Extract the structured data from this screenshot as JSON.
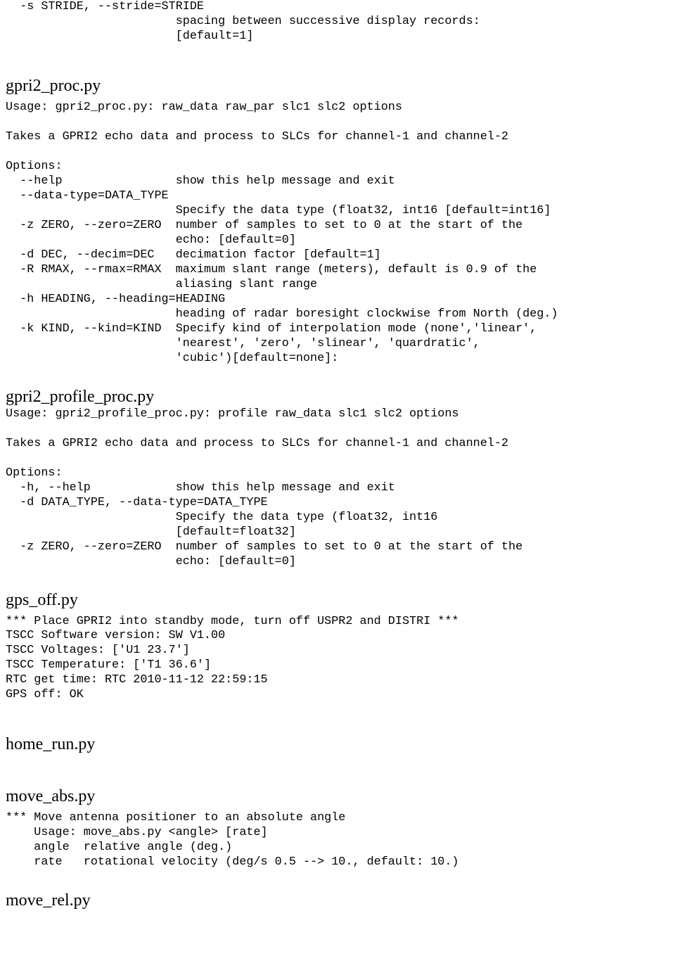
{
  "frag_top": "  -s STRIDE, --stride=STRIDE\n                        spacing between successive display records:\n                        [default=1]",
  "sections": [
    {
      "title": "gpri2_proc.py",
      "title_gap": "large",
      "body_before_gap": "small",
      "body": "Usage: gpri2_proc.py: raw_data raw_par slc1 slc2 options\n\nTakes a GPRI2 echo data and process to SLCs for channel-1 and channel-2\n\nOptions:\n  --help                show this help message and exit\n  --data-type=DATA_TYPE\n                        Specify the data type (float32, int16 [default=int16]\n  -z ZERO, --zero=ZERO  number of samples to set to 0 at the start of the\n                        echo: [default=0]\n  -d DEC, --decim=DEC   decimation factor [default=1]\n  -R RMAX, --rmax=RMAX  maximum slant range (meters), default is 0.9 of the\n                        aliasing slant range\n  -h HEADING, --heading=HEADING\n                        heading of radar boresight clockwise from North (deg.)\n  -k KIND, --kind=KIND  Specify kind of interpolation mode (none','linear',\n                        'nearest', 'zero', 'slinear', 'quardratic',\n                        'cubic')[default=none]:"
    },
    {
      "title": "gpri2_profile_proc.py",
      "title_gap": "med",
      "body_before_gap": "none",
      "body": "Usage: gpri2_profile_proc.py: profile raw_data slc1 slc2 options\n\nTakes a GPRI2 echo data and process to SLCs for channel-1 and channel-2\n\nOptions:\n  -h, --help            show this help message and exit\n  -d DATA_TYPE, --data-type=DATA_TYPE\n                        Specify the data type (float32, int16\n                        [default=float32]\n  -z ZERO, --zero=ZERO  number of samples to set to 0 at the start of the\n                        echo: [default=0]"
    },
    {
      "title": "gps_off.py",
      "title_gap": "med",
      "body_before_gap": "small",
      "body": "*** Place GPRI2 into standby mode, turn off USPR2 and DISTRI ***\nTSCC Software version: SW V1.00\nTSCC Voltages: ['U1 23.7']\nTSCC Temperature: ['T1 36.6']\nRTC get time: RTC 2010-11-12 22:59:15\nGPS off: OK"
    },
    {
      "title": "home_run.py",
      "title_gap": "large",
      "body_before_gap": "none",
      "body": ""
    },
    {
      "title": "move_abs.py",
      "title_gap": "large",
      "body_before_gap": "small",
      "body": "*** Move antenna positioner to an absolute angle\n    Usage: move_abs.py <angle> [rate]\n    angle  relative angle (deg.)\n    rate   rotational velocity (deg/s 0.5 --> 10., default: 10.)"
    },
    {
      "title": "move_rel.py",
      "title_gap": "med",
      "body_before_gap": "none",
      "body": ""
    }
  ]
}
